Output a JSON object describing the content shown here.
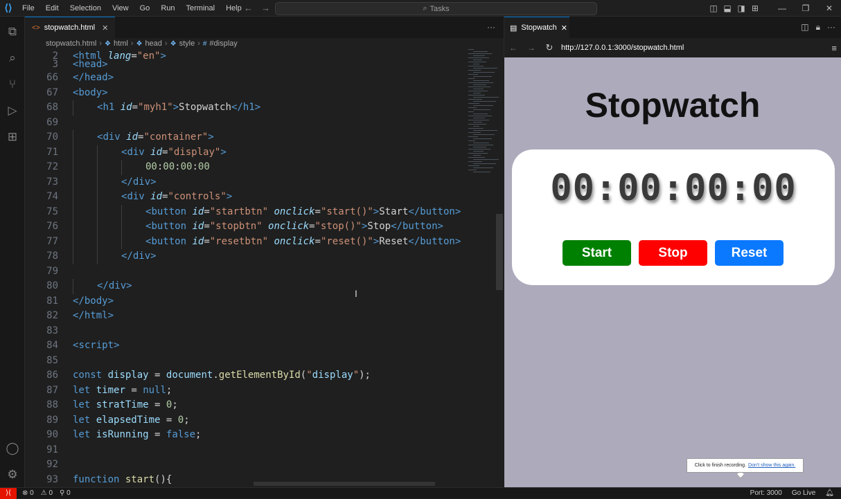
{
  "titlebar": {
    "menu": [
      "File",
      "Edit",
      "Selection",
      "View",
      "Go",
      "Run",
      "Terminal",
      "Help"
    ],
    "search_placeholder": "Tasks"
  },
  "editor": {
    "tab_label": "stopwatch.html",
    "breadcrumb": [
      "stopwatch.html",
      "html",
      "head",
      "style",
      "#display"
    ],
    "lines": [
      {
        "n": "2",
        "indent": 0,
        "code": "<html lang=\"en\">"
      },
      {
        "n": "3",
        "indent": 0,
        "code": "<head>"
      },
      {
        "n": "66",
        "indent": 0,
        "code": "</head>"
      },
      {
        "n": "67",
        "indent": 0,
        "code": "<body>"
      },
      {
        "n": "68",
        "indent": 1,
        "code": "<h1 id=\"myh1\">Stopwatch</h1>"
      },
      {
        "n": "69",
        "indent": 0,
        "code": ""
      },
      {
        "n": "70",
        "indent": 1,
        "code": "<div id=\"container\">"
      },
      {
        "n": "71",
        "indent": 2,
        "code": "<div id=\"display\">"
      },
      {
        "n": "72",
        "indent": 3,
        "code": "00:00:00:00"
      },
      {
        "n": "73",
        "indent": 2,
        "code": "</div>"
      },
      {
        "n": "74",
        "indent": 2,
        "code": "<div id=\"controls\">"
      },
      {
        "n": "75",
        "indent": 3,
        "code": "<button id=\"startbtn\" onclick=\"start()\">Start</button>"
      },
      {
        "n": "76",
        "indent": 3,
        "code": "<button id=\"stopbtn\" onclick=\"stop()\">Stop</button>"
      },
      {
        "n": "77",
        "indent": 3,
        "code": "<button id=\"resetbtn\" onclick=\"reset()\">Reset</button>"
      },
      {
        "n": "78",
        "indent": 2,
        "code": "</div>"
      },
      {
        "n": "79",
        "indent": 0,
        "code": ""
      },
      {
        "n": "80",
        "indent": 1,
        "code": "</div>"
      },
      {
        "n": "81",
        "indent": 0,
        "code": "</body>"
      },
      {
        "n": "82",
        "indent": 0,
        "code": "</html>"
      },
      {
        "n": "83",
        "indent": 0,
        "code": ""
      },
      {
        "n": "84",
        "indent": 0,
        "code": "<script>"
      },
      {
        "n": "85",
        "indent": 0,
        "code": ""
      },
      {
        "n": "86",
        "indent": 0,
        "code": "const display = document.getElementById(\"display\");"
      },
      {
        "n": "87",
        "indent": 0,
        "code": "let timer = null;"
      },
      {
        "n": "88",
        "indent": 0,
        "code": "let stratTime = 0;"
      },
      {
        "n": "89",
        "indent": 0,
        "code": "let elapsedTime = 0;"
      },
      {
        "n": "90",
        "indent": 0,
        "code": "let isRunning = false;"
      },
      {
        "n": "91",
        "indent": 0,
        "code": ""
      },
      {
        "n": "92",
        "indent": 0,
        "code": ""
      },
      {
        "n": "93",
        "indent": 0,
        "code": "function start(){"
      }
    ]
  },
  "preview": {
    "tab_label": "Stopwatch",
    "url": "http://127.0.0.1:3000/stopwatch.html",
    "page_title": "Stopwatch",
    "display": "00:00:00:00",
    "buttons": [
      {
        "label": "Start",
        "color": "#008000"
      },
      {
        "label": "Stop",
        "color": "#ff0000"
      },
      {
        "label": "Reset",
        "color": "#0a78ff"
      }
    ],
    "background": "#adaabc",
    "tooltip": {
      "text": "Click to finish recording.",
      "link": "Don't show this again."
    }
  },
  "statusbar": {
    "errors": "0",
    "warnings": "0",
    "ports": "0",
    "port": "Port: 3000",
    "golive": "Go Live"
  }
}
